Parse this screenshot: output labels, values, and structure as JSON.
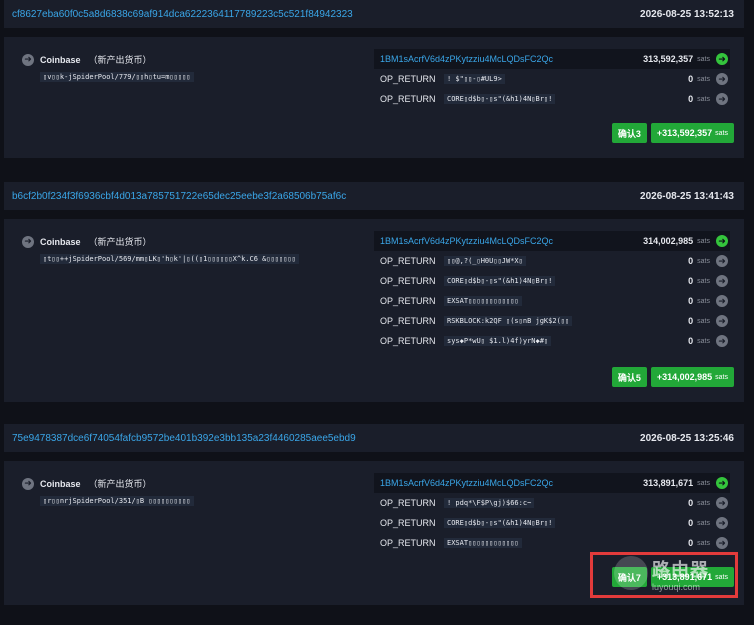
{
  "transactions": [
    {
      "hash": "cf8627eba60f0c5a8d6838c69af914dca6222364117789223c5c521f84942323",
      "time": "2026-08-25 13:52:13",
      "input": {
        "name": "Coinbase",
        "tag": "（新产出货币）",
        "script": "▯v▯▯k-jSpiderPool/779/▯▯h▯tu=m▯▯▯▯▯"
      },
      "outputs": [
        {
          "label": "1BM1sAcrfV6d4zPKytzziu4McLQDsFC2Qc",
          "script": "",
          "amount": "313,592,357",
          "unit": "sats",
          "is_address": true
        },
        {
          "label": "OP_RETURN",
          "script": "! $\"▯▯-▯#UL9>",
          "amount": "0",
          "unit": "sats",
          "is_address": false
        },
        {
          "label": "OP_RETURN",
          "script": "CORE▯d$b▯-▯s\"(&h1)4N▯Br▯!",
          "amount": "0",
          "unit": "sats",
          "is_address": false
        }
      ],
      "confirm": "确认3",
      "total": "+313,592,357",
      "total_unit": "sats"
    },
    {
      "hash": "b6cf2b0f234f3f6936cbf4d013a785751722e65dec25eebe3f2a68506b75af6c",
      "time": "2026-08-25 13:41:43",
      "input": {
        "name": "Coinbase",
        "tag": "（新产出货币）",
        "script": "▯t▯▯++jSpiderPool/569/mm▯LK▯'h▯k'|▯((▯1▯▯▯▯▯▯X^k.C6 &▯▯▯▯▯▯▯"
      },
      "outputs": [
        {
          "label": "1BM1sAcrfV6d4zPKytzziu4McLQDsFC2Qc",
          "script": "",
          "amount": "314,002,985",
          "unit": "sats",
          "is_address": true
        },
        {
          "label": "OP_RETURN",
          "script": "▯▯@,?(_▯H0U▯▯JW*X▯",
          "amount": "0",
          "unit": "sats",
          "is_address": false
        },
        {
          "label": "OP_RETURN",
          "script": "CORE▯d$b▯-▯s\"(&h1)4N▯Br▯!",
          "amount": "0",
          "unit": "sats",
          "is_address": false
        },
        {
          "label": "OP_RETURN",
          "script": "EXSAT▯▯▯▯▯▯▯▯▯▯▯▯",
          "amount": "0",
          "unit": "sats",
          "is_address": false
        },
        {
          "label": "OP_RETURN",
          "script": "RSKBLOCK:k2QF ▯(s▯nB  jgK$2(▯▯",
          "amount": "0",
          "unit": "sats",
          "is_address": false
        },
        {
          "label": "OP_RETURN",
          "script": "sys◆P*wU▯ $1.l)4f)yrN◆#▯",
          "amount": "0",
          "unit": "sats",
          "is_address": false
        }
      ],
      "confirm": "确认5",
      "total": "+314,002,985",
      "total_unit": "sats"
    },
    {
      "hash": "75e9478387dce6f74054fafcb9572be401b392e3bb135a23f4460285aee5ebd9",
      "time": "2026-08-25 13:25:46",
      "input": {
        "name": "Coinbase",
        "tag": "（新产出货币）",
        "script": "▯r▯▯nrjSpiderPool/351/▯B ▯▯▯▯▯▯▯▯▯▯"
      },
      "outputs": [
        {
          "label": "1BM1sAcrfV6d4zPKytzziu4McLQDsFC2Qc",
          "script": "",
          "amount": "313,891,671",
          "unit": "sats",
          "is_address": true
        },
        {
          "label": "OP_RETURN",
          "script": "! pdq*\\F$P\\gj)$66:c~",
          "amount": "0",
          "unit": "sats",
          "is_address": false
        },
        {
          "label": "OP_RETURN",
          "script": "CORE▯d$b▯-▯s\"(&h1)4N▯Br▯!",
          "amount": "0",
          "unit": "sats",
          "is_address": false
        },
        {
          "label": "OP_RETURN",
          "script": "EXSAT▯▯▯▯▯▯▯▯▯▯▯▯",
          "amount": "0",
          "unit": "sats",
          "is_address": false
        }
      ],
      "confirm": "确认7",
      "total": "+313,891,671",
      "total_unit": "sats"
    }
  ],
  "watermark": {
    "text": "路由器",
    "sub": "luyouqi.com"
  },
  "colors": {
    "accent": "#3aa6e8",
    "confirm_green": "#22a838",
    "highlight_red": "#e23b3b"
  }
}
